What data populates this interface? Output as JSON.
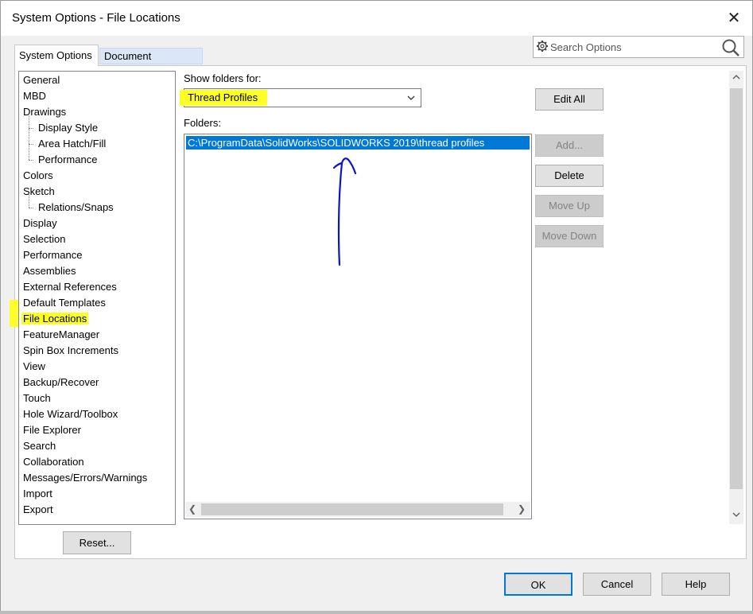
{
  "window": {
    "title": "System Options - File Locations",
    "close_glyph": "✕"
  },
  "search": {
    "placeholder": "Search Options"
  },
  "tabs": [
    {
      "label": "System Options",
      "active": true
    },
    {
      "label": "Document Properties",
      "active": false
    }
  ],
  "tree": [
    {
      "label": "General",
      "level": 0
    },
    {
      "label": "MBD",
      "level": 0
    },
    {
      "label": "Drawings",
      "level": 0
    },
    {
      "label": "Display Style",
      "level": 1
    },
    {
      "label": "Area Hatch/Fill",
      "level": 1
    },
    {
      "label": "Performance",
      "level": 1
    },
    {
      "label": "Colors",
      "level": 0
    },
    {
      "label": "Sketch",
      "level": 0
    },
    {
      "label": "Relations/Snaps",
      "level": 1
    },
    {
      "label": "Display",
      "level": 0
    },
    {
      "label": "Selection",
      "level": 0
    },
    {
      "label": "Performance",
      "level": 0
    },
    {
      "label": "Assemblies",
      "level": 0
    },
    {
      "label": "External References",
      "level": 0
    },
    {
      "label": "Default Templates",
      "level": 0
    },
    {
      "label": "File Locations",
      "level": 0,
      "selected": true
    },
    {
      "label": "FeatureManager",
      "level": 0
    },
    {
      "label": "Spin Box Increments",
      "level": 0
    },
    {
      "label": "View",
      "level": 0
    },
    {
      "label": "Backup/Recover",
      "level": 0
    },
    {
      "label": "Touch",
      "level": 0
    },
    {
      "label": "Hole Wizard/Toolbox",
      "level": 0
    },
    {
      "label": "File Explorer",
      "level": 0
    },
    {
      "label": "Search",
      "level": 0
    },
    {
      "label": "Collaboration",
      "level": 0
    },
    {
      "label": "Messages/Errors/Warnings",
      "level": 0
    },
    {
      "label": "Import",
      "level": 0
    },
    {
      "label": "Export",
      "level": 0
    }
  ],
  "reset_label": "Reset...",
  "show_folders": {
    "label": "Show folders for:",
    "value": "Thread Profiles"
  },
  "folders": {
    "label": "Folders:",
    "items": [
      "C:\\ProgramData\\SolidWorks\\SOLIDWORKS 2019\\thread profiles"
    ]
  },
  "side_buttons": {
    "edit_all": "Edit All",
    "add": "Add...",
    "delete": "Delete",
    "move_up": "Move Up",
    "move_down": "Move Down"
  },
  "footer": {
    "ok": "OK",
    "cancel": "Cancel",
    "help": "Help"
  },
  "colors": {
    "highlight": "#ffff28",
    "selection": "#0078d7",
    "annotation": "#0a14c8"
  }
}
